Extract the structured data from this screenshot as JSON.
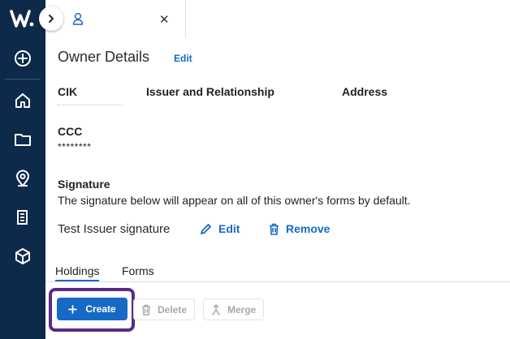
{
  "tab": {
    "close_label": "✕"
  },
  "owner": {
    "title": "Owner Details",
    "edit_label": "Edit",
    "columns": [
      "CIK",
      "Issuer and Relationship",
      "Address"
    ],
    "ccc_label": "CCC",
    "ccc_value": "********"
  },
  "signature": {
    "label": "Signature",
    "description": "The signature below will appear on all of this owner's forms by default.",
    "name": "Test Issuer signature",
    "edit_label": "Edit",
    "remove_label": "Remove"
  },
  "subtabs": [
    {
      "label": "Holdings",
      "active": true
    },
    {
      "label": "Forms",
      "active": false
    }
  ],
  "actions": {
    "create_label": "Create",
    "delete_label": "Delete",
    "merge_label": "Merge"
  },
  "colors": {
    "rail": "#0d2a4a",
    "accent": "#1669c4",
    "highlight": "#5b2a86"
  }
}
